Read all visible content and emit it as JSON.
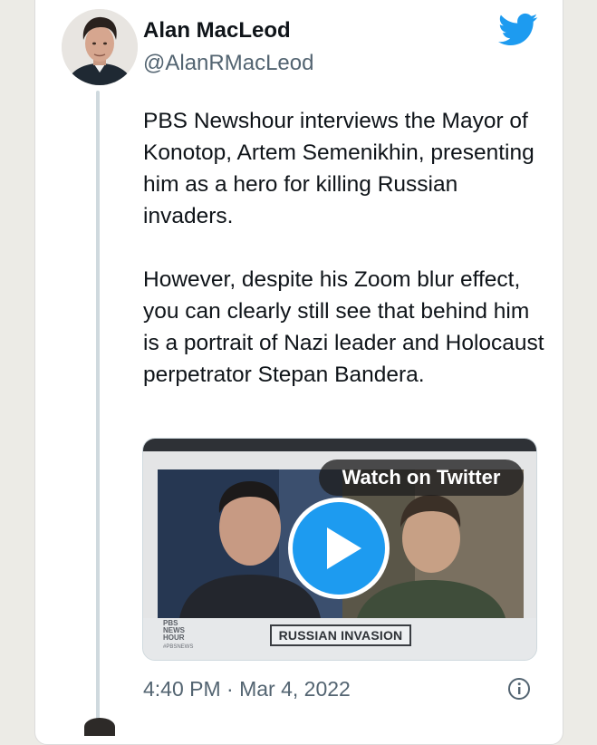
{
  "author": {
    "name": "Alan MacLeod",
    "handle": "@AlanRMacLeod"
  },
  "icons": {
    "brand": "twitter-bird-icon",
    "play": "play-icon",
    "info": "info-icon"
  },
  "tweet": {
    "paragraphs": [
      "PBS Newshour interviews the Mayor of Konotop, Artem Semenikhin, presenting him as a hero for killing Russian invaders.",
      "However, despite his Zoom blur effect, you can clearly still see that behind him is a portrait of Nazi leader and Holocaust perpetrator Stepan Bandera."
    ],
    "timestamp": "4:40 PM · Mar 4, 2022"
  },
  "media": {
    "watch_label": "Watch on Twitter",
    "chyron": "RUSSIAN INVASION",
    "logo_lines": [
      "PBS",
      "NEWS",
      "HOUR"
    ],
    "logo_tag": "#PBSNEWS"
  },
  "colors": {
    "twitter_blue": "#1d9bf0",
    "text": "#0f1419",
    "secondary_text": "#536471"
  }
}
